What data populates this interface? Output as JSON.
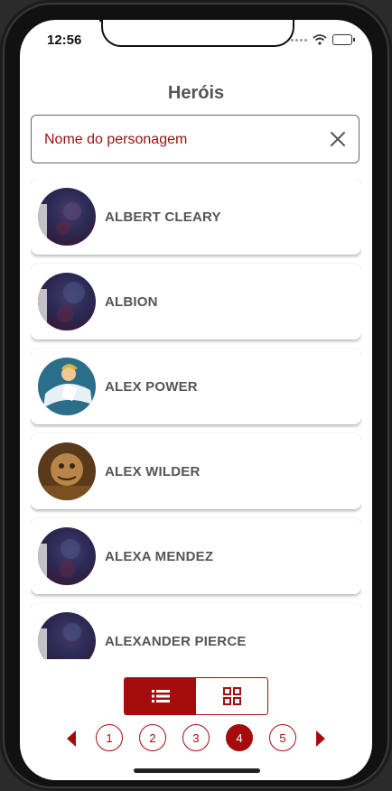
{
  "status": {
    "time": "12:56"
  },
  "header": {
    "title": "Heróis"
  },
  "search": {
    "placeholder": "Nome do personagem",
    "value": ""
  },
  "heroes": [
    {
      "name": "ALBERT CLEARY",
      "avatar": "image-not-available-avatar"
    },
    {
      "name": "ALBION",
      "avatar": "image-not-available-avatar"
    },
    {
      "name": "ALEX POWER",
      "avatar": "alex-power-avatar"
    },
    {
      "name": "ALEX WILDER",
      "avatar": "alex-wilder-avatar"
    },
    {
      "name": "ALEXA MENDEZ",
      "avatar": "image-not-available-avatar"
    },
    {
      "name": "ALEXANDER PIERCE",
      "avatar": "image-not-available-avatar"
    }
  ],
  "view_toggle": {
    "selected": "list",
    "options": [
      "list",
      "grid"
    ]
  },
  "pagination": {
    "pages": [
      "1",
      "2",
      "3",
      "4",
      "5"
    ],
    "current": "4"
  },
  "colors": {
    "accent": "#a50d0d",
    "text_primary": "#555555",
    "placeholder": "#9b0f0f"
  }
}
